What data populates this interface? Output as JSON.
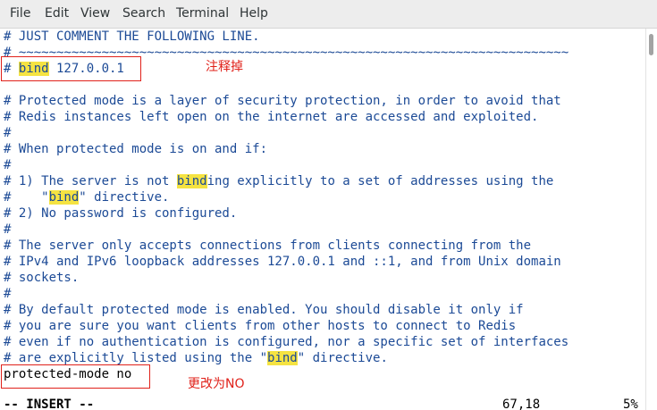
{
  "menu": [
    "File",
    "Edit",
    "View",
    "Search",
    "Terminal",
    "Help"
  ],
  "lines": [
    {
      "text": "# JUST COMMENT THE FOLLOWING LINE."
    },
    {
      "text": "# ~~~~~~~~~~~~~~~~~~~~~~~~~~~~~~~~~~~~~~~~~~~~~~~~~~~~~~~~~~~~~~~~~~~~~~~~~"
    },
    {
      "pre": "# ",
      "hl": "bind",
      "post": " 127.0.0.1"
    },
    {
      "text": ""
    },
    {
      "text": "# Protected mode is a layer of security protection, in order to avoid that"
    },
    {
      "text": "# Redis instances left open on the internet are accessed and exploited."
    },
    {
      "text": "#"
    },
    {
      "text": "# When protected mode is on and if:"
    },
    {
      "text": "#"
    },
    {
      "pre": "# 1) The server is not ",
      "hl": "bind",
      "post": "ing explicitly to a set of addresses using the"
    },
    {
      "pre": "#    \"",
      "hl": "bind",
      "post": "\" directive."
    },
    {
      "text": "# 2) No password is configured."
    },
    {
      "text": "#"
    },
    {
      "text": "# The server only accepts connections from clients connecting from the"
    },
    {
      "text": "# IPv4 and IPv6 loopback addresses 127.0.0.1 and ::1, and from Unix domain"
    },
    {
      "text": "# sockets."
    },
    {
      "text": "#"
    },
    {
      "text": "# By default protected mode is enabled. You should disable it only if"
    },
    {
      "text": "# you are sure you want clients from other hosts to connect to Redis"
    },
    {
      "text": "# even if no authentication is configured, nor a specific set of interfaces"
    },
    {
      "pre": "# are explicitly listed using the \"",
      "hl": "bind",
      "post": "\" directive."
    },
    {
      "text": "protected-mode no",
      "plain": true
    }
  ],
  "status": {
    "mode": "-- INSERT --",
    "position": "67,18",
    "percent": "5%"
  },
  "annotations": {
    "comment_out": "注释掉",
    "change_to_no": "更改为NO"
  },
  "colors": {
    "comment": "#1c4a96",
    "highlight": "#f5e342",
    "annotation": "#e0211a"
  }
}
